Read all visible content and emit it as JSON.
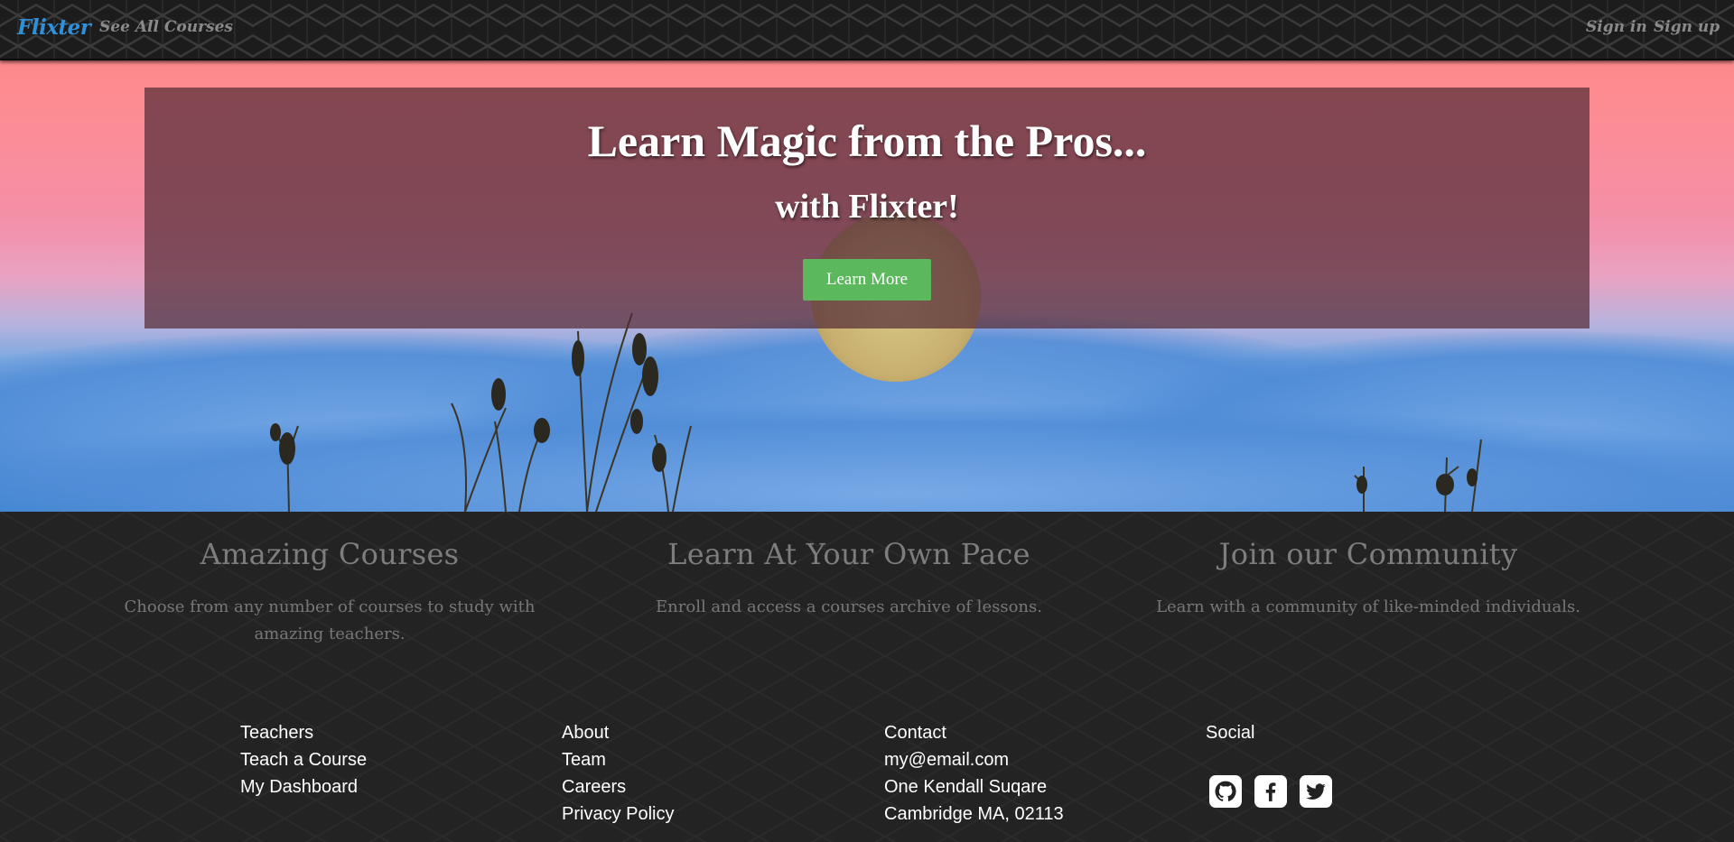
{
  "nav": {
    "brand": "Flixter",
    "courses_link": "See All Courses",
    "signin": "Sign in",
    "signup": "Sign up"
  },
  "hero": {
    "title": "Learn Magic from the Pros...",
    "subtitle": "with Flixter!",
    "button": "Learn More"
  },
  "features": [
    {
      "title": "Amazing Courses",
      "text": "Choose from any number of courses to study with amazing teachers."
    },
    {
      "title": "Learn At Your Own Pace",
      "text": "Enroll and access a courses archive of lessons."
    },
    {
      "title": "Join our Community",
      "text": "Learn with a community of like-minded individuals."
    }
  ],
  "footer": {
    "teachers": {
      "heading": "Teachers",
      "links": [
        "Teach a Course",
        "My Dashboard"
      ]
    },
    "about": {
      "heading": "About",
      "links": [
        "Team",
        "Careers",
        "Privacy Policy"
      ]
    },
    "contact": {
      "heading": "Contact",
      "lines": [
        "my@email.com",
        "One Kendall Suqare",
        "Cambridge MA, 02113"
      ]
    },
    "social": {
      "heading": "Social",
      "icons": [
        "github-icon",
        "facebook-icon",
        "twitter-icon"
      ]
    }
  },
  "colors": {
    "brand": "#2f8fd8",
    "button": "#5cb85c",
    "background_dark": "#232323"
  }
}
